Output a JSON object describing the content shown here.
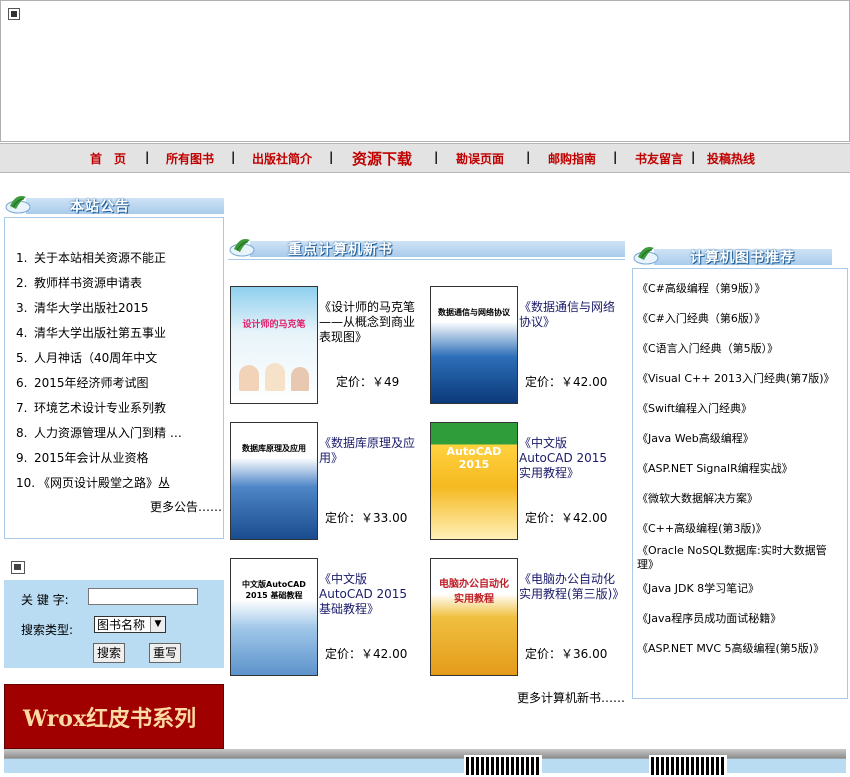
{
  "nav": {
    "items": [
      "首　页",
      "所有图书",
      "出版社简介",
      "资源下载",
      "勘误页面",
      "邮购指南",
      "书友留言",
      "投稿热线"
    ]
  },
  "notice": {
    "title": "本站公告",
    "items": [
      {
        "num": "1.",
        "text": "关于本站相关资源不能正"
      },
      {
        "num": "2.",
        "text": "教师样书资源申请表"
      },
      {
        "num": "3.",
        "text": "清华大学出版社2015"
      },
      {
        "num": "4.",
        "text": "清华大学出版社第五事业"
      },
      {
        "num": "5.",
        "text": "人月神话（40周年中文"
      },
      {
        "num": "6.",
        "text": "2015年经济师考试图"
      },
      {
        "num": "7.",
        "text": "环境艺术设计专业系列教"
      },
      {
        "num": "8.",
        "text": "人力资源管理从入门到精 …"
      },
      {
        "num": "9.",
        "text": "2015年会计从业资格"
      },
      {
        "num": "10.",
        "text": "《网页设计殿堂之路》丛"
      }
    ],
    "more": "更多公告……"
  },
  "search": {
    "keyword_label": "关 键 字:",
    "keyword_value": "",
    "type_label": "搜索类型:",
    "type_value": "图书名称",
    "search_button": "搜索",
    "reset_button": "重写"
  },
  "wrox": {
    "text": "Wrox红皮书系列"
  },
  "featured": {
    "title": "重点计算机新书",
    "more": "更多计算机新书……",
    "books": [
      {
        "title": "《设计师的马克笔——从概念到商业表现图》",
        "price": "定价：￥49",
        "cover_text": "设计师的马克笔"
      },
      {
        "title": "《数据通信与网络协议》",
        "price": "定价：￥42.00",
        "cover_text": "数据通信与网络协议"
      },
      {
        "title": "《数据库原理及应用》",
        "price": "定价：￥33.00",
        "cover_text": "数据库原理及应用"
      },
      {
        "title": "《中文版AutoCAD 2015实用教程》",
        "price": "定价：￥42.00",
        "cover_text": "AutoCAD 2015"
      },
      {
        "title": "《中文版AutoCAD 2015基础教程》",
        "price": "定价：￥42.00",
        "cover_text": "中文版AutoCAD 2015 基础教程"
      },
      {
        "title": "《电脑办公自动化实用教程(第三版)》",
        "price": "定价：￥36.00",
        "cover_text": "电脑办公自动化 实用教程"
      }
    ]
  },
  "recommend": {
    "title": "计算机图书推荐",
    "items": [
      "《C#高级编程（第9版）》",
      "《C#入门经典（第6版）》",
      "《C语言入门经典（第5版）》",
      "《Visual C++ 2013入门经典(第7版)》",
      "《Swift编程入门经典》",
      "《Java Web高级编程》",
      "《ASP.NET SignalR编程实战》",
      "《微软大数据解决方案》",
      "《C++高级编程(第3版)》",
      "《Oracle NoSQL数据库:实时大数据管理》",
      "《Java JDK 8学习笔记》",
      "《Java程序员成功面试秘籍》",
      "《ASP.NET MVC 5高级编程(第5版)》"
    ]
  }
}
